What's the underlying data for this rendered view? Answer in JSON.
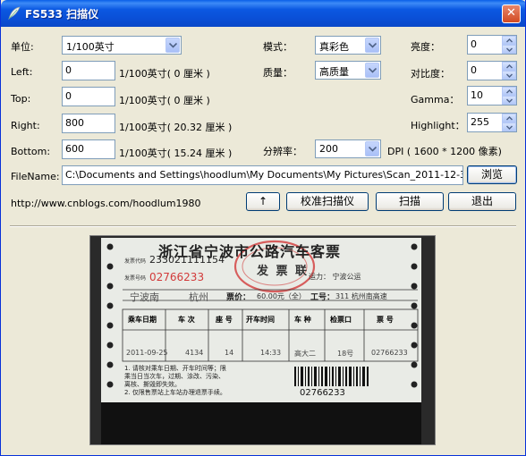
{
  "window": {
    "title": "FS533  扫描仪",
    "close_glyph": "✕"
  },
  "labels": {
    "unit": "单位:",
    "left": "Left:",
    "top": "Top:",
    "right": "Right:",
    "bottom": "Bottom:",
    "mode": "模式：",
    "quality": "质量：",
    "resolution": "分辨率：",
    "brightness": "亮度：",
    "contrast": "对比度：",
    "gamma": "Gamma：",
    "highlight": "Highlight：",
    "filename": "FileName:"
  },
  "unit": {
    "selected": "1/100英寸"
  },
  "margins": {
    "left": {
      "value": "0",
      "suffix": "1/100英寸( 0 厘米 )"
    },
    "top": {
      "value": "0",
      "suffix": "1/100英寸( 0 厘米 )"
    },
    "right": {
      "value": "800",
      "suffix": "1/100英寸( 20.32 厘米 )"
    },
    "bottom": {
      "value": "600",
      "suffix": "1/100英寸( 15.24 厘米 )"
    }
  },
  "mode": {
    "selected": "真彩色"
  },
  "quality": {
    "selected": "高质量"
  },
  "resolution": {
    "selected": "200",
    "dpi_text": "DPI ( 1600 * 1200 像素)"
  },
  "brightness": "0",
  "contrast": "0",
  "gamma": "10",
  "highlight": "255",
  "filename": {
    "value": "C:\\Documents and Settings\\hoodlum\\My Documents\\My Pictures\\Scan_2011-12-30_01.jpg",
    "browse_label": "浏览"
  },
  "footer": {
    "url": "http://www.cnblogs.com/hoodlum1980",
    "up_label": "↑",
    "calibrate_label": "校准扫描仪",
    "scan_label": "扫描",
    "exit_label": "退出"
  },
  "ticket": {
    "title": "浙江省宁波市公路汽车客票",
    "code": "233021111154",
    "serial": "02766233",
    "stamp_text": "发 票 联",
    "route_from": "宁波南",
    "route_to": "杭州",
    "fare_label": "票价：",
    "fare": "60.00元（全）",
    "window_label": "工号：",
    "window": "311  杭州南高速",
    "carrier": "运力：  宁波公运",
    "headers": [
      "乘车日期",
      "车 次",
      "座 号",
      "开车时间",
      "车 种",
      "检票口",
      "票 号"
    ],
    "row": [
      "2011-09-25",
      "4134",
      "14",
      "14:33",
      "高大二",
      "18号",
      "02766233"
    ],
    "notes": [
      "1. 请核对乘车日期、开车时间等；限",
      "乘当日当次车，过期、涂改、污染、",
      "离核、撕毁即失效。",
      "2. 仅限售票站上车站办理退票手续。"
    ],
    "barcode_number": "02766233",
    "side_label_1": "发票代码",
    "side_label_2": "发票号码"
  },
  "colors": {
    "titlebar": "#0a58e2",
    "window_bg": "#ece9d8",
    "stamp_red": "#d23a3a",
    "ticket_paper": "#e9ebe6"
  }
}
